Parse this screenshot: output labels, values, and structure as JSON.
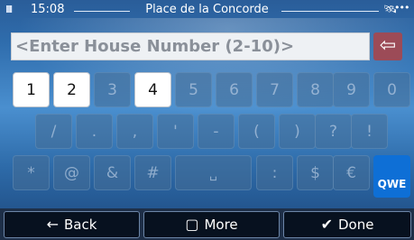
{
  "status": {
    "time": "15:08",
    "street": "Place de la Concorde",
    "signal": "IIIII",
    "gps": "🛰",
    "menu": "•••"
  },
  "input": {
    "placeholder": "<Enter House Number (2-10)>",
    "backspace": "⇦"
  },
  "keys": {
    "row1": [
      "1",
      "2",
      "3",
      "4",
      "5",
      "6",
      "7",
      "8",
      "9",
      "0"
    ],
    "row2": [
      "/",
      ".",
      ",",
      "'",
      "-",
      "(",
      ")",
      "?",
      "!"
    ],
    "row3": [
      "*",
      "@",
      "&",
      "#",
      "␣",
      ":",
      "$",
      "€"
    ],
    "layout_switch": "QWE"
  },
  "enabled_keys": [
    "1",
    "2",
    "4"
  ],
  "buttons": {
    "back": "Back",
    "more": "More",
    "done": "Done"
  },
  "icons": {
    "back": "←",
    "more": "▢",
    "done": "✔"
  },
  "colors": {
    "accent": "#0e6fd6",
    "backspace": "#9c4b57"
  }
}
